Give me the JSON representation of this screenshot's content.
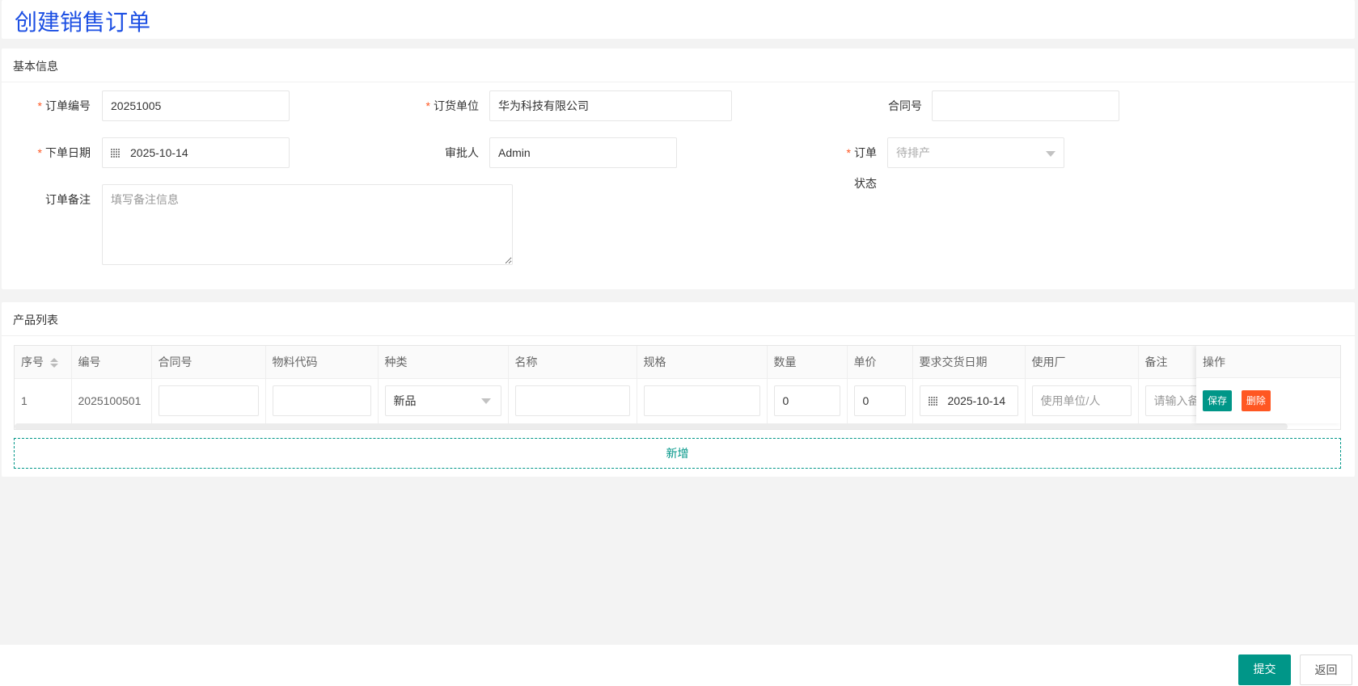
{
  "page_title": "创建销售订单",
  "basic": {
    "section_title": "基本信息",
    "order_no": {
      "label": "订单编号",
      "value": "20251005"
    },
    "customer": {
      "label": "订货单位",
      "value": "华为科技有限公司"
    },
    "contract": {
      "label": "合同号",
      "value": ""
    },
    "order_date": {
      "label": "下单日期",
      "value": "2025-10-14"
    },
    "approver": {
      "label": "审批人",
      "value": "Admin"
    },
    "status": {
      "label_line1": "订单",
      "label_line2": "状态",
      "value": "待排产"
    },
    "remark": {
      "label": "订单备注",
      "placeholder": "填写备注信息"
    },
    "required_mark": "*"
  },
  "products": {
    "section_title": "产品列表",
    "columns": [
      "序号",
      "编号",
      "合同号",
      "物料代码",
      "种类",
      "名称",
      "规格",
      "数量",
      "单价",
      "要求交货日期",
      "使用厂",
      "备注",
      "操作"
    ],
    "rows": [
      {
        "seq": "1",
        "code": "2025100501",
        "contract": "",
        "material": "",
        "kind": "新品",
        "name": "",
        "spec": "",
        "qty": "0",
        "price": "0",
        "delivery_date": "2025-10-14",
        "factory_placeholder": "使用单位/人",
        "remark_placeholder": "请输入备注",
        "save": "保存",
        "delete": "删除"
      }
    ],
    "add_label": "新增"
  },
  "footer": {
    "submit": "提交",
    "back": "返回"
  },
  "colors": {
    "primary": "#009688",
    "danger": "#ff5722",
    "title": "#1c4fe3"
  }
}
